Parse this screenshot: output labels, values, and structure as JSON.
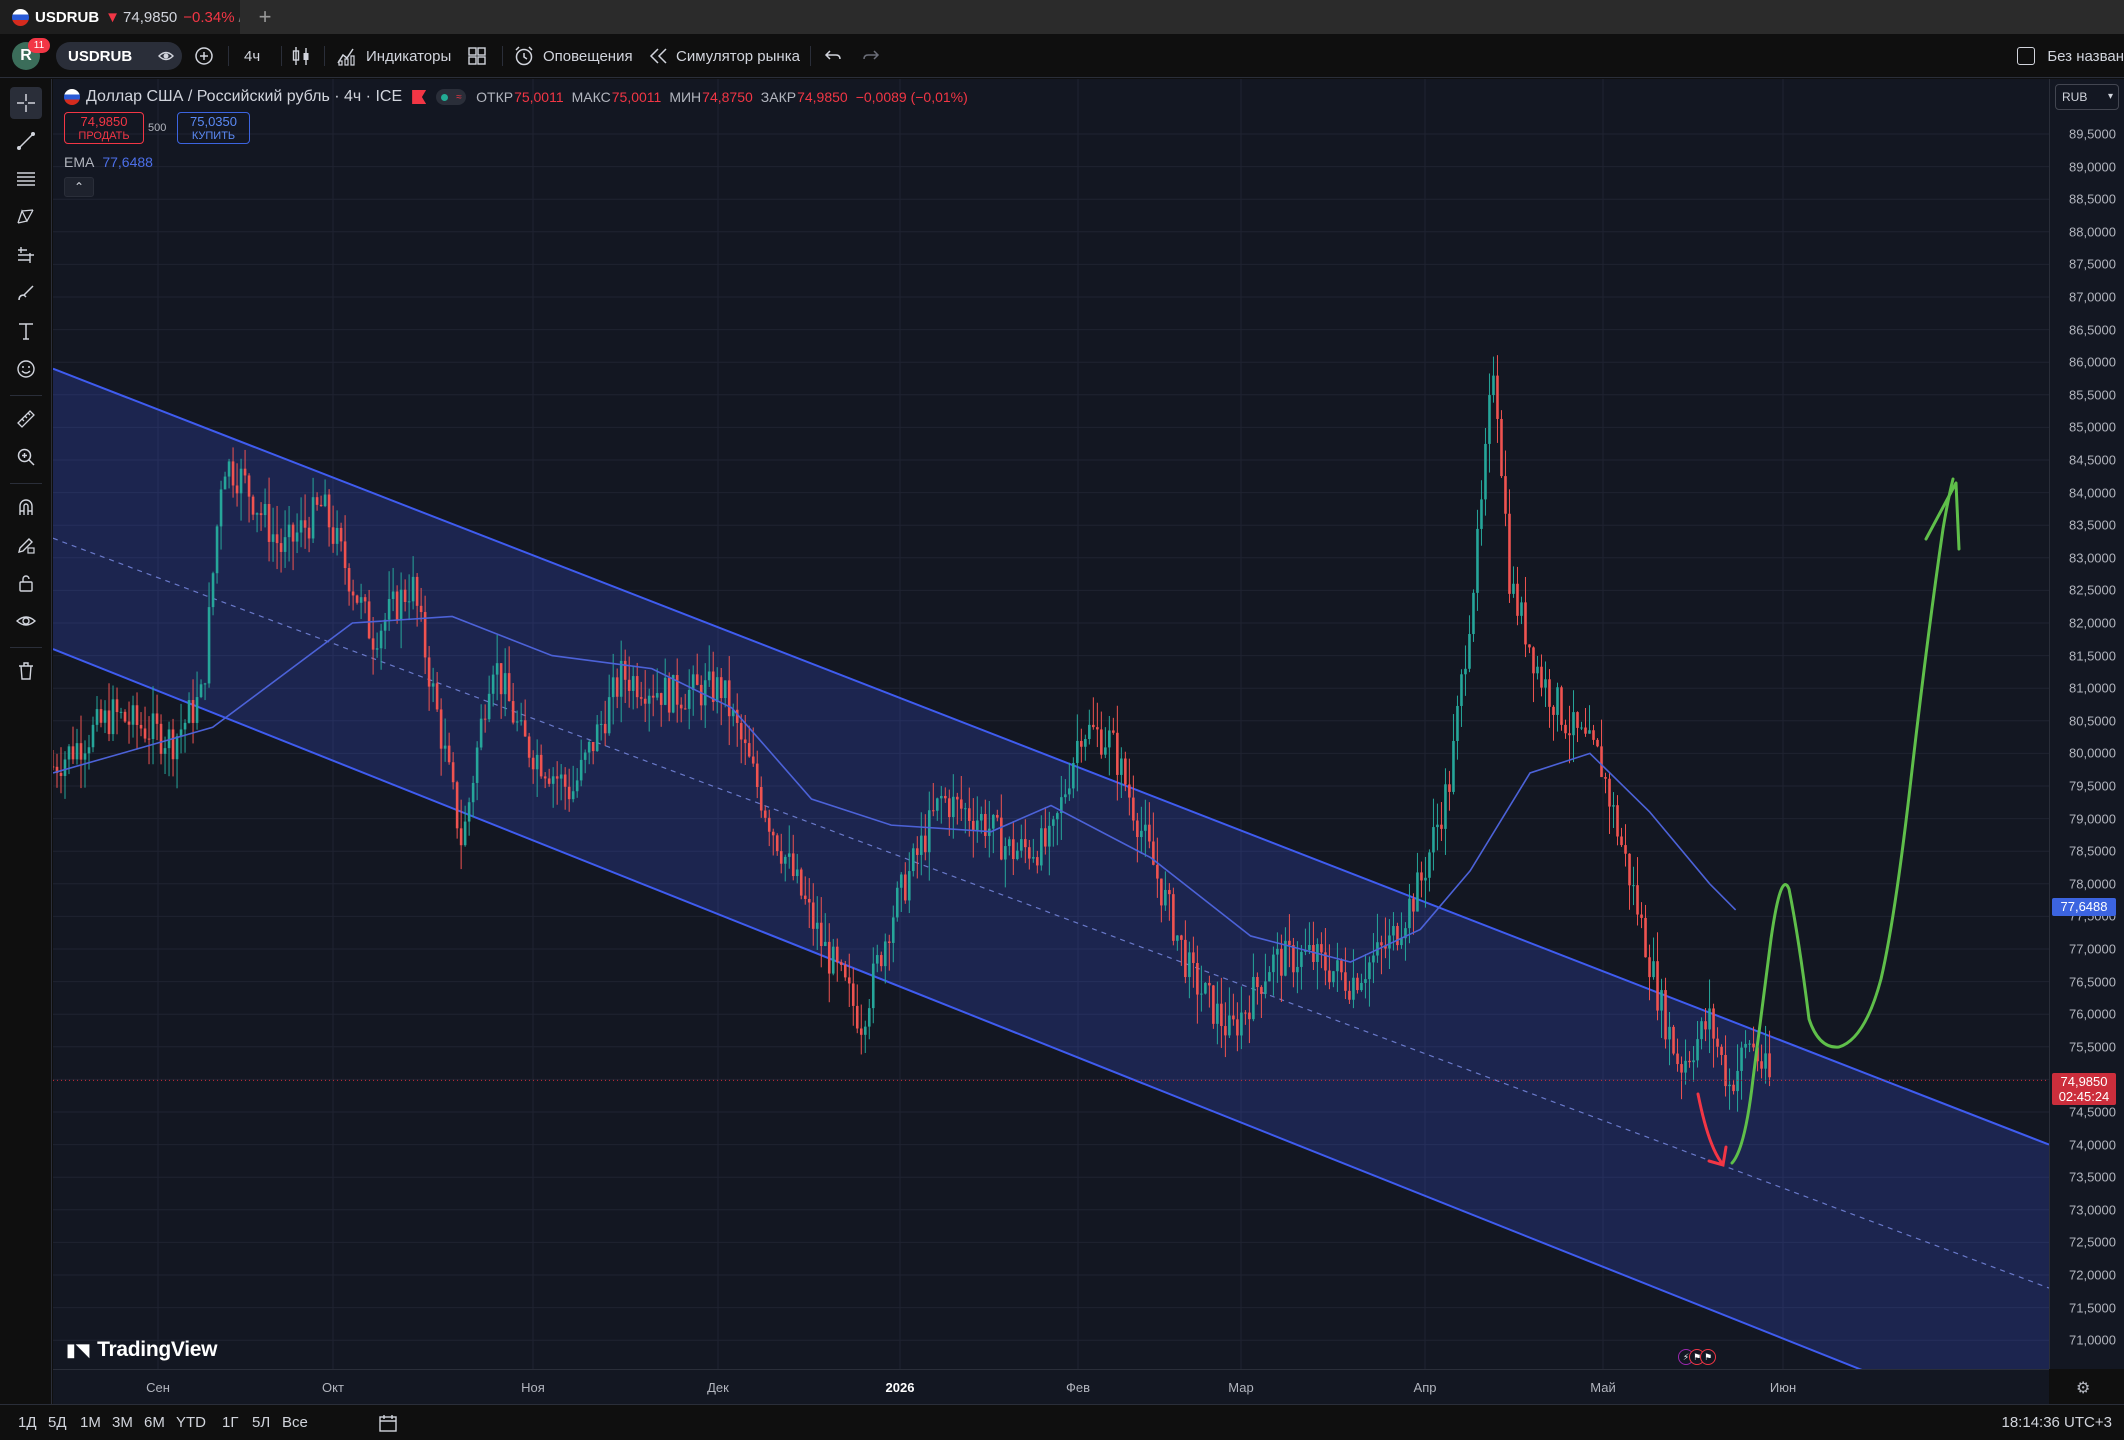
{
  "browser": {
    "tab_symbol": "USDRUB",
    "tab_arrow": "▼",
    "tab_price": "74,9850",
    "tab_change": "−0.34%",
    "tab_rest": "/ Б",
    "add_tab": "+"
  },
  "toolbar": {
    "avatar_letter": "R",
    "notification_count": "11",
    "symbol": "USDRUB",
    "interval": "4ч",
    "indicators_label": "Индикаторы",
    "alerts_label": "Оповещения",
    "replay_label": "Симулятор рынка",
    "layout_name": "Без назван"
  },
  "legend": {
    "title": "Доллар США / Российский рубль · 4ч · ICE",
    "open_label": "ОТКР",
    "open": "75,0011",
    "high_label": "МАКС",
    "high": "75,0011",
    "low_label": "МИН",
    "low": "74,8750",
    "close_label": "ЗАКР",
    "close": "74,9850",
    "change": "−0,0089 (−0,01%)"
  },
  "trade": {
    "sell_price": "74,9850",
    "sell_label": "ПРОДАТЬ",
    "spread": "500",
    "buy_price": "75,0350",
    "buy_label": "КУПИТЬ"
  },
  "ema": {
    "label": "EMA",
    "value": "77,6488"
  },
  "collapse_glyph": "⌃",
  "currency": "RUB",
  "badges": {
    "ema_value": "77,6488",
    "last_price": "74,9850",
    "countdown": "02:45:24"
  },
  "price_axis": [
    "89,5000",
    "89,0000",
    "88,5000",
    "88,0000",
    "87,5000",
    "87,0000",
    "86,5000",
    "86,0000",
    "85,5000",
    "85,0000",
    "84,5000",
    "84,0000",
    "83,5000",
    "83,0000",
    "82,5000",
    "82,0000",
    "81,5000",
    "81,0000",
    "80,5000",
    "80,0000",
    "79,5000",
    "79,0000",
    "78,5000",
    "78,0000",
    "77,5000",
    "77,0000",
    "76,5000",
    "76,0000",
    "75,5000",
    "75,0000",
    "74,5000",
    "74,0000",
    "73,5000",
    "73,0000",
    "72,5000",
    "72,0000",
    "71,5000",
    "71,0000"
  ],
  "time_axis": [
    {
      "label": "Сен",
      "bold": false
    },
    {
      "label": "Окт",
      "bold": false
    },
    {
      "label": "Ноя",
      "bold": false
    },
    {
      "label": "Дек",
      "bold": false
    },
    {
      "label": "2026",
      "bold": true
    },
    {
      "label": "Фев",
      "bold": false
    },
    {
      "label": "Мар",
      "bold": false
    },
    {
      "label": "Апр",
      "bold": false
    },
    {
      "label": "Май",
      "bold": false
    },
    {
      "label": "Июн",
      "bold": false
    }
  ],
  "ranges": [
    "1Д",
    "5Д",
    "1М",
    "3М",
    "6М",
    "YTD",
    "1Г",
    "5Л",
    "Все"
  ],
  "clock": "18:14:36 UTC+3",
  "logo_text": "TradingView",
  "colors": {
    "up": "#26a69a",
    "down": "#ef5350",
    "channel": "#3f5cf0",
    "ema": "#4c62d8",
    "green_drawing": "#5fbf4a",
    "red_drawing": "#f23645"
  },
  "chart_data": {
    "type": "candlestick",
    "symbol": "USDRUB",
    "interval": "4ч",
    "ylim": [
      70.6,
      89.8
    ],
    "anchors": [
      {
        "t": 0.0,
        "p": 79.8
      },
      {
        "t": 0.03,
        "p": 80.6
      },
      {
        "t": 0.06,
        "p": 80.2
      },
      {
        "t": 0.075,
        "p": 80.9
      },
      {
        "t": 0.085,
        "p": 84.5
      },
      {
        "t": 0.095,
        "p": 84.2
      },
      {
        "t": 0.115,
        "p": 83.1
      },
      {
        "t": 0.135,
        "p": 83.8
      },
      {
        "t": 0.16,
        "p": 81.8
      },
      {
        "t": 0.18,
        "p": 82.6
      },
      {
        "t": 0.205,
        "p": 78.6
      },
      {
        "t": 0.22,
        "p": 81.5
      },
      {
        "t": 0.235,
        "p": 80.2
      },
      {
        "t": 0.26,
        "p": 79.4
      },
      {
        "t": 0.285,
        "p": 81.2
      },
      {
        "t": 0.31,
        "p": 80.9
      },
      {
        "t": 0.335,
        "p": 81.0
      },
      {
        "t": 0.36,
        "p": 78.9
      },
      {
        "t": 0.385,
        "p": 77.1
      },
      {
        "t": 0.405,
        "p": 75.9
      },
      {
        "t": 0.42,
        "p": 77.5
      },
      {
        "t": 0.445,
        "p": 79.3
      },
      {
        "t": 0.465,
        "p": 79.0
      },
      {
        "t": 0.48,
        "p": 78.5
      },
      {
        "t": 0.5,
        "p": 78.6
      },
      {
        "t": 0.515,
        "p": 80.4
      },
      {
        "t": 0.53,
        "p": 80.2
      },
      {
        "t": 0.55,
        "p": 78.4
      },
      {
        "t": 0.57,
        "p": 76.6
      },
      {
        "t": 0.59,
        "p": 75.7
      },
      {
        "t": 0.61,
        "p": 76.8
      },
      {
        "t": 0.63,
        "p": 76.9
      },
      {
        "t": 0.65,
        "p": 76.5
      },
      {
        "t": 0.67,
        "p": 77.1
      },
      {
        "t": 0.685,
        "p": 78.0
      },
      {
        "t": 0.7,
        "p": 79.6
      },
      {
        "t": 0.715,
        "p": 83.5
      },
      {
        "t": 0.722,
        "p": 86.1
      },
      {
        "t": 0.73,
        "p": 82.6
      },
      {
        "t": 0.745,
        "p": 81.2
      },
      {
        "t": 0.76,
        "p": 80.4
      },
      {
        "t": 0.775,
        "p": 79.9
      },
      {
        "t": 0.79,
        "p": 78.1
      },
      {
        "t": 0.805,
        "p": 76.2
      },
      {
        "t": 0.815,
        "p": 75.2
      },
      {
        "t": 0.83,
        "p": 75.9
      },
      {
        "t": 0.84,
        "p": 74.9
      },
      {
        "t": 0.85,
        "p": 75.6
      },
      {
        "t": 0.86,
        "p": 74.98
      }
    ],
    "ema": {
      "name": "EMA",
      "last": 77.6488,
      "points": [
        {
          "t": 0.0,
          "p": 79.7
        },
        {
          "t": 0.08,
          "p": 80.4
        },
        {
          "t": 0.15,
          "p": 82.0
        },
        {
          "t": 0.2,
          "p": 82.1
        },
        {
          "t": 0.25,
          "p": 81.5
        },
        {
          "t": 0.3,
          "p": 81.3
        },
        {
          "t": 0.34,
          "p": 80.7
        },
        {
          "t": 0.38,
          "p": 79.3
        },
        {
          "t": 0.42,
          "p": 78.9
        },
        {
          "t": 0.47,
          "p": 78.8
        },
        {
          "t": 0.5,
          "p": 79.2
        },
        {
          "t": 0.55,
          "p": 78.4
        },
        {
          "t": 0.6,
          "p": 77.2
        },
        {
          "t": 0.65,
          "p": 76.8
        },
        {
          "t": 0.685,
          "p": 77.3
        },
        {
          "t": 0.71,
          "p": 78.2
        },
        {
          "t": 0.74,
          "p": 79.7
        },
        {
          "t": 0.77,
          "p": 80.0
        },
        {
          "t": 0.8,
          "p": 79.1
        },
        {
          "t": 0.83,
          "p": 78.0
        },
        {
          "t": 0.843,
          "p": 77.6
        }
      ]
    },
    "channel": {
      "upper": [
        {
          "t": 0.0,
          "p": 85.9
        },
        {
          "t": 1.0,
          "p": 74.0
        }
      ],
      "middle": [
        {
          "t": 0.0,
          "p": 83.3
        },
        {
          "t": 1.0,
          "p": 71.8
        }
      ],
      "lower": [
        {
          "t": 0.0,
          "p": 81.6
        },
        {
          "t": 1.0,
          "p": 69.4
        }
      ]
    },
    "last_price": 74.985
  }
}
